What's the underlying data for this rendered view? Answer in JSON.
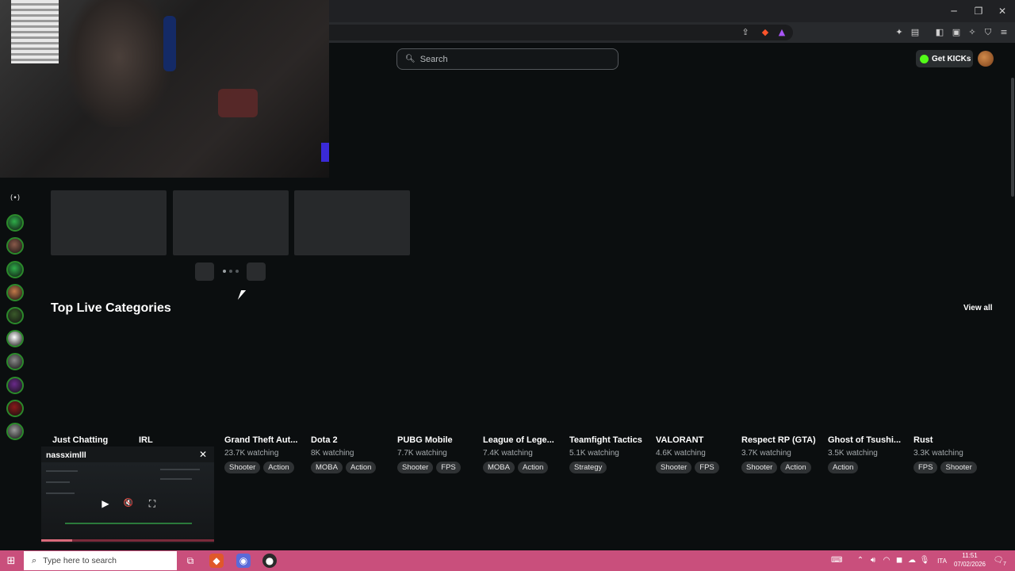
{
  "browser": {
    "window_controls": [
      "─",
      "❐",
      "✕"
    ],
    "toolbar_icons": [
      "share-icon",
      "brave-shield-icon",
      "brave-rewards-icon",
      "extensions-icon",
      "sidebar-icon",
      "wallet-icon",
      "leo-icon",
      "vpn-icon",
      "menu-icon"
    ]
  },
  "header": {
    "search_placeholder": "Search",
    "get_kicks_label": "Get KICKs"
  },
  "sidebar": {
    "live_icon": "(•)",
    "channels": [
      {
        "color": "#2fae4a"
      },
      {
        "color": "#8a5a4a"
      },
      {
        "color": "#2fae4a"
      },
      {
        "color": "#c47a4a"
      },
      {
        "color": "#3a5a2a"
      },
      {
        "color": "#ffffff"
      },
      {
        "color": "#8a8a8a"
      },
      {
        "color": "#6a2a8a"
      },
      {
        "color": "#8a1a1a"
      },
      {
        "color": "#9a9a9a"
      }
    ]
  },
  "section": {
    "title": "Top Live Categories",
    "view_all": "View all"
  },
  "categories": [
    {
      "name": "Just Chatting",
      "watching": "",
      "tags": []
    },
    {
      "name": "IRL",
      "watching": "",
      "tags": []
    },
    {
      "name": "Grand Theft Aut...",
      "watching": "23.7K watching",
      "tags": [
        "Shooter",
        "Action"
      ]
    },
    {
      "name": "Dota 2",
      "watching": "8K watching",
      "tags": [
        "MOBA",
        "Action"
      ]
    },
    {
      "name": "PUBG Mobile",
      "watching": "7.7K watching",
      "tags": [
        "Shooter",
        "FPS"
      ]
    },
    {
      "name": "League of Lege...",
      "watching": "7.4K watching",
      "tags": [
        "MOBA",
        "Action"
      ]
    },
    {
      "name": "Teamfight Tactics",
      "watching": "5.1K watching",
      "tags": [
        "Strategy"
      ]
    },
    {
      "name": "VALORANT",
      "watching": "4.6K watching",
      "tags": [
        "Shooter",
        "FPS"
      ]
    },
    {
      "name": "Respect RP (GTA)",
      "watching": "3.7K watching",
      "tags": [
        "Shooter",
        "Action"
      ]
    },
    {
      "name": "Ghost of Tsushi...",
      "watching": "3.5K watching",
      "tags": [
        "Action"
      ]
    },
    {
      "name": "Rust",
      "watching": "3.3K watching",
      "tags": [
        "FPS",
        "Shooter"
      ]
    }
  ],
  "mini_player": {
    "channel": "nassximlll",
    "close": "✕",
    "play": "▶",
    "mute": "🔇",
    "fullscreen": "⛶",
    "progress": 0.18
  },
  "taskbar": {
    "search_placeholder": "Type here to search",
    "language": "ITA",
    "time": "11:51",
    "date": "07/02/2026",
    "notifications": "7"
  }
}
